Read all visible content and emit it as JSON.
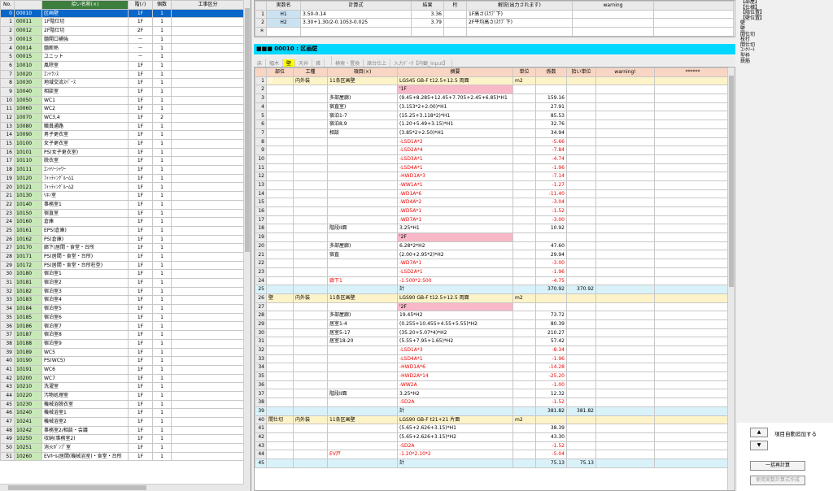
{
  "left_grid": {
    "columns": [
      "No.",
      "",
      "拾い名称(×)",
      "階(ﾉ)",
      "個数",
      "工事区分"
    ],
    "rows": [
      {
        "no": "0",
        "code": "00010",
        "name": "区画壁",
        "floor": "1F",
        "count": "1"
      },
      {
        "no": "1",
        "code": "00011",
        "name": "1F階仕切",
        "floor": "1F",
        "count": "1"
      },
      {
        "no": "2",
        "code": "00012",
        "name": "2F階仕切",
        "floor": "2F",
        "count": "1"
      },
      {
        "no": "3",
        "code": "00013",
        "name": "髄開口補強",
        "floor": "－",
        "count": "1"
      },
      {
        "no": "4",
        "code": "00014",
        "name": "髄断熱",
        "floor": "－",
        "count": "1"
      },
      {
        "no": "5",
        "code": "00015",
        "name": "ユニット",
        "floor": "－",
        "count": "1"
      },
      {
        "no": "6",
        "code": "10010",
        "name": "風除室",
        "floor": "1F",
        "count": "1"
      },
      {
        "no": "7",
        "code": "10020",
        "name": "ｴﾝﾄﾗﾝｽ",
        "floor": "1F",
        "count": "1"
      },
      {
        "no": "8",
        "code": "10030",
        "name": "地域交流ｽﾍﾟｰｽ",
        "floor": "1F",
        "count": "1"
      },
      {
        "no": "9",
        "code": "10040",
        "name": "相談室",
        "floor": "1F",
        "count": "1"
      },
      {
        "no": "10",
        "code": "10050",
        "name": "WC1",
        "floor": "1F",
        "count": "1"
      },
      {
        "no": "11",
        "code": "10060",
        "name": "WC2",
        "floor": "1F",
        "count": "1"
      },
      {
        "no": "12",
        "code": "10070",
        "name": "WC3,4",
        "floor": "1F",
        "count": "2"
      },
      {
        "no": "13",
        "code": "10080",
        "name": "職員通路",
        "floor": "1F",
        "count": "1"
      },
      {
        "no": "14",
        "code": "10090",
        "name": "男子更衣室",
        "floor": "1F",
        "count": "1"
      },
      {
        "no": "15",
        "code": "10100",
        "name": "女子更衣室",
        "floor": "1F",
        "count": "1"
      },
      {
        "no": "16",
        "code": "10101",
        "name": "PS(女子更衣室)",
        "floor": "1F",
        "count": "1"
      },
      {
        "no": "17",
        "code": "10110",
        "name": "脱衣室",
        "floor": "1F",
        "count": "1"
      },
      {
        "no": "18",
        "code": "10111",
        "name": "ｴﾝﾄﾘｰｼｬﾜｰ",
        "floor": "1F",
        "count": "1"
      },
      {
        "no": "19",
        "code": "10120",
        "name": "ﾌｨｯﾃｨﾝｸﾞﾙｰﾑ1",
        "floor": "1F",
        "count": "1"
      },
      {
        "no": "20",
        "code": "10121",
        "name": "ﾌｨｯﾃｨﾝｸﾞﾙｰﾑ2",
        "floor": "1F",
        "count": "1"
      },
      {
        "no": "21",
        "code": "10130",
        "name": "ﾘﾈﾝ室",
        "floor": "1F",
        "count": "1"
      },
      {
        "no": "22",
        "code": "10140",
        "name": "事務室1",
        "floor": "1F",
        "count": "1"
      },
      {
        "no": "23",
        "code": "10150",
        "name": "宿直室",
        "floor": "1F",
        "count": "1"
      },
      {
        "no": "24",
        "code": "10160",
        "name": "倉庫",
        "floor": "1F",
        "count": "1"
      },
      {
        "no": "25",
        "code": "10161",
        "name": "EPS(倉庫)",
        "floor": "1F",
        "count": "1"
      },
      {
        "no": "26",
        "code": "10162",
        "name": "PS(倉庫)",
        "floor": "1F",
        "count": "1"
      },
      {
        "no": "27",
        "code": "10170",
        "name": "廊下/居間・食堂・台所",
        "floor": "1F",
        "count": "1"
      },
      {
        "no": "28",
        "code": "10171",
        "name": "PS(居間・食堂・台所)",
        "floor": "1F",
        "count": "1"
      },
      {
        "no": "29",
        "code": "10172",
        "name": "PS(居間・食堂・台所柱型)",
        "floor": "1F",
        "count": "1"
      },
      {
        "no": "30",
        "code": "10180",
        "name": "宿泊室1",
        "floor": "1F",
        "count": "1"
      },
      {
        "no": "31",
        "code": "10181",
        "name": "宿泊室2",
        "floor": "1F",
        "count": "1"
      },
      {
        "no": "32",
        "code": "10182",
        "name": "宿泊室3",
        "floor": "1F",
        "count": "1"
      },
      {
        "no": "33",
        "code": "10183",
        "name": "宿泊室4",
        "floor": "1F",
        "count": "1"
      },
      {
        "no": "34",
        "code": "10184",
        "name": "宿泊室5",
        "floor": "1F",
        "count": "1"
      },
      {
        "no": "35",
        "code": "10185",
        "name": "宿泊室6",
        "floor": "1F",
        "count": "1"
      },
      {
        "no": "36",
        "code": "10186",
        "name": "宿泊室7",
        "floor": "1F",
        "count": "1"
      },
      {
        "no": "37",
        "code": "10187",
        "name": "宿泊室8",
        "floor": "1F",
        "count": "1"
      },
      {
        "no": "38",
        "code": "10188",
        "name": "宿泊室9",
        "floor": "1F",
        "count": "1"
      },
      {
        "no": "39",
        "code": "10189",
        "name": "WC5",
        "floor": "1F",
        "count": "1"
      },
      {
        "no": "40",
        "code": "10190",
        "name": "PS(WC5)",
        "floor": "1F",
        "count": "1"
      },
      {
        "no": "41",
        "code": "10191",
        "name": "WC6",
        "floor": "1F",
        "count": "1"
      },
      {
        "no": "42",
        "code": "10200",
        "name": "WC7",
        "floor": "1F",
        "count": "1"
      },
      {
        "no": "43",
        "code": "10210",
        "name": "洗濯室",
        "floor": "1F",
        "count": "1"
      },
      {
        "no": "44",
        "code": "10220",
        "name": "汚物処理室",
        "floor": "1F",
        "count": "1"
      },
      {
        "no": "45",
        "code": "10230",
        "name": "機械浴脱衣室",
        "floor": "1F",
        "count": "1"
      },
      {
        "no": "46",
        "code": "10240",
        "name": "機械浴室1",
        "floor": "1F",
        "count": "1"
      },
      {
        "no": "47",
        "code": "10241",
        "name": "機械浴室2",
        "floor": "1F",
        "count": "1"
      },
      {
        "no": "48",
        "code": "10242",
        "name": "事務室2/相談・会議",
        "floor": "1F",
        "count": "1"
      },
      {
        "no": "49",
        "code": "10250",
        "name": "収納(事務室2)",
        "floor": "1F",
        "count": "1"
      },
      {
        "no": "50",
        "code": "10251",
        "name": "消火ﾎﾟﾝﾌﾟ室",
        "floor": "1F",
        "count": "1"
      },
      {
        "no": "51",
        "code": "10260",
        "name": "EVﾎｰﾙ/居間(機械浴室)・食堂・台所",
        "floor": "1F",
        "count": "1"
      }
    ]
  },
  "top_grid": {
    "columns": [
      "",
      "実数名",
      "計算式",
      "結果",
      "桁",
      "解説(出力されます)",
      "warning"
    ],
    "rows": [
      {
        "rn": "1",
        "name": "H1",
        "formula": "3.50-0.14",
        "result": "3.36",
        "digits": "",
        "note": "1F高さ(ｽﾗﾌﾞ下)",
        "warning": ""
      },
      {
        "rn": "2",
        "name": "H2",
        "formula": "3.30+1.30/2-0.1053-0.025",
        "result": "3.79",
        "digits": "",
        "note": "2F平均高さ(ｽﾗﾌﾞ下)",
        "warning": ""
      },
      {
        "rn": "＊",
        "name": "",
        "formula": "",
        "result": "",
        "digits": "",
        "note": "",
        "warning": ""
      }
    ]
  },
  "section_title": "■■■ 00010 : 区画壁",
  "tabs": [
    {
      "label": "床",
      "active": false
    },
    {
      "label": "幅木",
      "active": false
    },
    {
      "label": "壁",
      "active": true
    },
    {
      "label": "天井",
      "active": false
    },
    {
      "label": "雑",
      "active": false
    },
    {
      "label": "",
      "active": false
    },
    {
      "label": "検索・置換",
      "active": false
    },
    {
      "label": "諸台仕上",
      "active": false
    },
    {
      "label": "入力ﾃﾞｰﾀ【内観_Input】",
      "active": false
    }
  ],
  "main_grid": {
    "columns": [
      "",
      "部位",
      "工種",
      "項目(×)",
      "摘要",
      "単位",
      "係数",
      "拾い単位",
      "warning!",
      "******"
    ],
    "rows": [
      {
        "rn": "1",
        "part": "壁",
        "trade": "内外装",
        "item": "11条区画壁",
        "desc": "LGS45 GB-F t12.5+12.5 両面",
        "unit": "m2",
        "coef": "",
        "pickup": "",
        "warn": "",
        "extra": "",
        "type": "top",
        "sel": true
      },
      {
        "rn": "2",
        "desc": "'1F",
        "type": "pink"
      },
      {
        "rn": "3",
        "item": "多部屋廊)",
        "desc": "(9.45+8.285+12.45+7.705+2.45+6.85)*H1",
        "coef": "159.16"
      },
      {
        "rn": "4",
        "item": "宿直室)",
        "desc": "(3.153*2+2.00)*H1",
        "coef": "27.91"
      },
      {
        "rn": "5",
        "item": "宿泊1-7",
        "desc": "(15.25+3.118*2)*H1",
        "coef": "85.53"
      },
      {
        "rn": "6",
        "item": "宿泊8,9",
        "desc": "(1.20+5.49+3.15)*H1",
        "coef": "32.76"
      },
      {
        "rn": "7",
        "item": "相談",
        "desc": "(3.85*2+2.50)*H1",
        "coef": "34.94"
      },
      {
        "rn": "8",
        "desc": "-LSD1A*2",
        "coef": "-5.66",
        "red": true
      },
      {
        "rn": "9",
        "desc": "-LSD2A*4",
        "coef": "-7.84",
        "red": true
      },
      {
        "rn": "10",
        "desc": "-LSD3A*1",
        "coef": "-4.74",
        "red": true
      },
      {
        "rn": "11",
        "desc": "-LSD4A*1",
        "coef": "-1.96",
        "red": true
      },
      {
        "rn": "12",
        "desc": "-HWD1A*3",
        "coef": "-7.14",
        "red": true
      },
      {
        "rn": "13",
        "desc": "-WW1A*1",
        "coef": "-1.27",
        "red": true
      },
      {
        "rn": "14",
        "desc": "-WD1A*6",
        "coef": "-11.40",
        "red": true
      },
      {
        "rn": "15",
        "desc": "-WD4A*2",
        "coef": "-3.04",
        "red": true
      },
      {
        "rn": "16",
        "desc": "-WD5A*1",
        "coef": "-1.52",
        "red": true
      },
      {
        "rn": "17",
        "desc": "-WD7A*1",
        "coef": "-3.00",
        "red": true
      },
      {
        "rn": "18",
        "item": "階段II面",
        "desc": "3.25*H1",
        "coef": "10.92"
      },
      {
        "rn": "19",
        "desc": "'2F",
        "type": "pink"
      },
      {
        "rn": "20",
        "item": "多部屋廊)",
        "desc": "6.28*2*H2",
        "coef": "47.60"
      },
      {
        "rn": "21",
        "item": "宿直",
        "desc": "(2.00+2.95*2)*H2",
        "coef": "29.94"
      },
      {
        "rn": "22",
        "desc": "-WD7A*1",
        "coef": "-3.00",
        "red": true
      },
      {
        "rn": "23",
        "desc": "-LSD2A*1",
        "coef": "-1.96",
        "red": true
      },
      {
        "rn": "24",
        "item": "廊下1",
        "itemRed": true,
        "desc": "-1.500*2.500",
        "coef": "-4.75",
        "red": true
      },
      {
        "rn": "25",
        "desc": "計",
        "coef": "370.92",
        "pickup": "370.92",
        "type": "sum"
      },
      {
        "rn": "26",
        "part": "壁",
        "trade": "内外装",
        "item": "11条区画壁",
        "desc": "LGS90 GB-F t12.5+12.5 両面",
        "unit": "m2",
        "type": "top"
      },
      {
        "rn": "27",
        "desc": "'2F",
        "type": "pink"
      },
      {
        "rn": "28",
        "item": "多部屋廊)",
        "desc": "19.45*H2",
        "coef": "73.72"
      },
      {
        "rn": "29",
        "item": "居室1-4",
        "desc": "(0.255+10.455+4.55+5.55)*H2",
        "coef": "80.39"
      },
      {
        "rn": "30",
        "item": "居室5-17",
        "desc": "(35.20+5.07*4)*H2",
        "coef": "210.27"
      },
      {
        "rn": "31",
        "item": "居室18-20",
        "desc": "(5.55+7.95+1.65)*H2",
        "coef": "57.42"
      },
      {
        "rn": "32",
        "desc": "-LSD1A*3",
        "coef": "-8.34",
        "red": true
      },
      {
        "rn": "33",
        "desc": "-LSD4A*1",
        "coef": "-1.96",
        "red": true
      },
      {
        "rn": "34",
        "desc": "-HWD1A*6",
        "coef": "-14.28",
        "red": true
      },
      {
        "rn": "35",
        "desc": "-HWD2A*14",
        "coef": "-25.20",
        "red": true
      },
      {
        "rn": "36",
        "desc": "-WW2A",
        "coef": "-1.00",
        "red": true
      },
      {
        "rn": "37",
        "item": "階段II面",
        "desc": "3.25*H2",
        "coef": "12.32"
      },
      {
        "rn": "38",
        "desc": "-SD2A",
        "coef": "-1.52",
        "red": true
      },
      {
        "rn": "39",
        "desc": "計",
        "coef": "381.82",
        "pickup": "381.82",
        "type": "sum"
      },
      {
        "rn": "40",
        "part": "間仕切",
        "trade": "内外装",
        "item": "11条区画壁",
        "desc": "LGS90 GB-F t21+21 片面",
        "unit": "m2",
        "type": "top"
      },
      {
        "rn": "41",
        "desc": "(5.65+2.626+3.15)*H1",
        "coef": "38.39"
      },
      {
        "rn": "42",
        "desc": "(5.65+2.626+3.15)*H2",
        "coef": "43.30"
      },
      {
        "rn": "43",
        "desc": "-SD2A",
        "coef": "-1.52",
        "red": true
      },
      {
        "rn": "44",
        "item": "EV戸",
        "itemRed": true,
        "desc": "-1.20*2.10*2",
        "coef": "-5.04",
        "red": true
      },
      {
        "rn": "45",
        "desc": "計",
        "coef": "75.13",
        "pickup": "75.13",
        "type": "sum"
      }
    ]
  },
  "right_list": [
    "【部屋】",
    "【仕様】",
    "【階位置】",
    "【壁位置】",
    "壁",
    "壁",
    "間仕切",
    "枝打",
    "間仕切",
    "ｺﾝｸﾘｰﾄ",
    "型枠",
    "鉄筋"
  ],
  "controls": {
    "auto_add_label": "項目自動追加する",
    "up": "▲",
    "down": "▼",
    "recalc": "一括再計算",
    "disabled_btn": "使用実数計算式作成"
  }
}
